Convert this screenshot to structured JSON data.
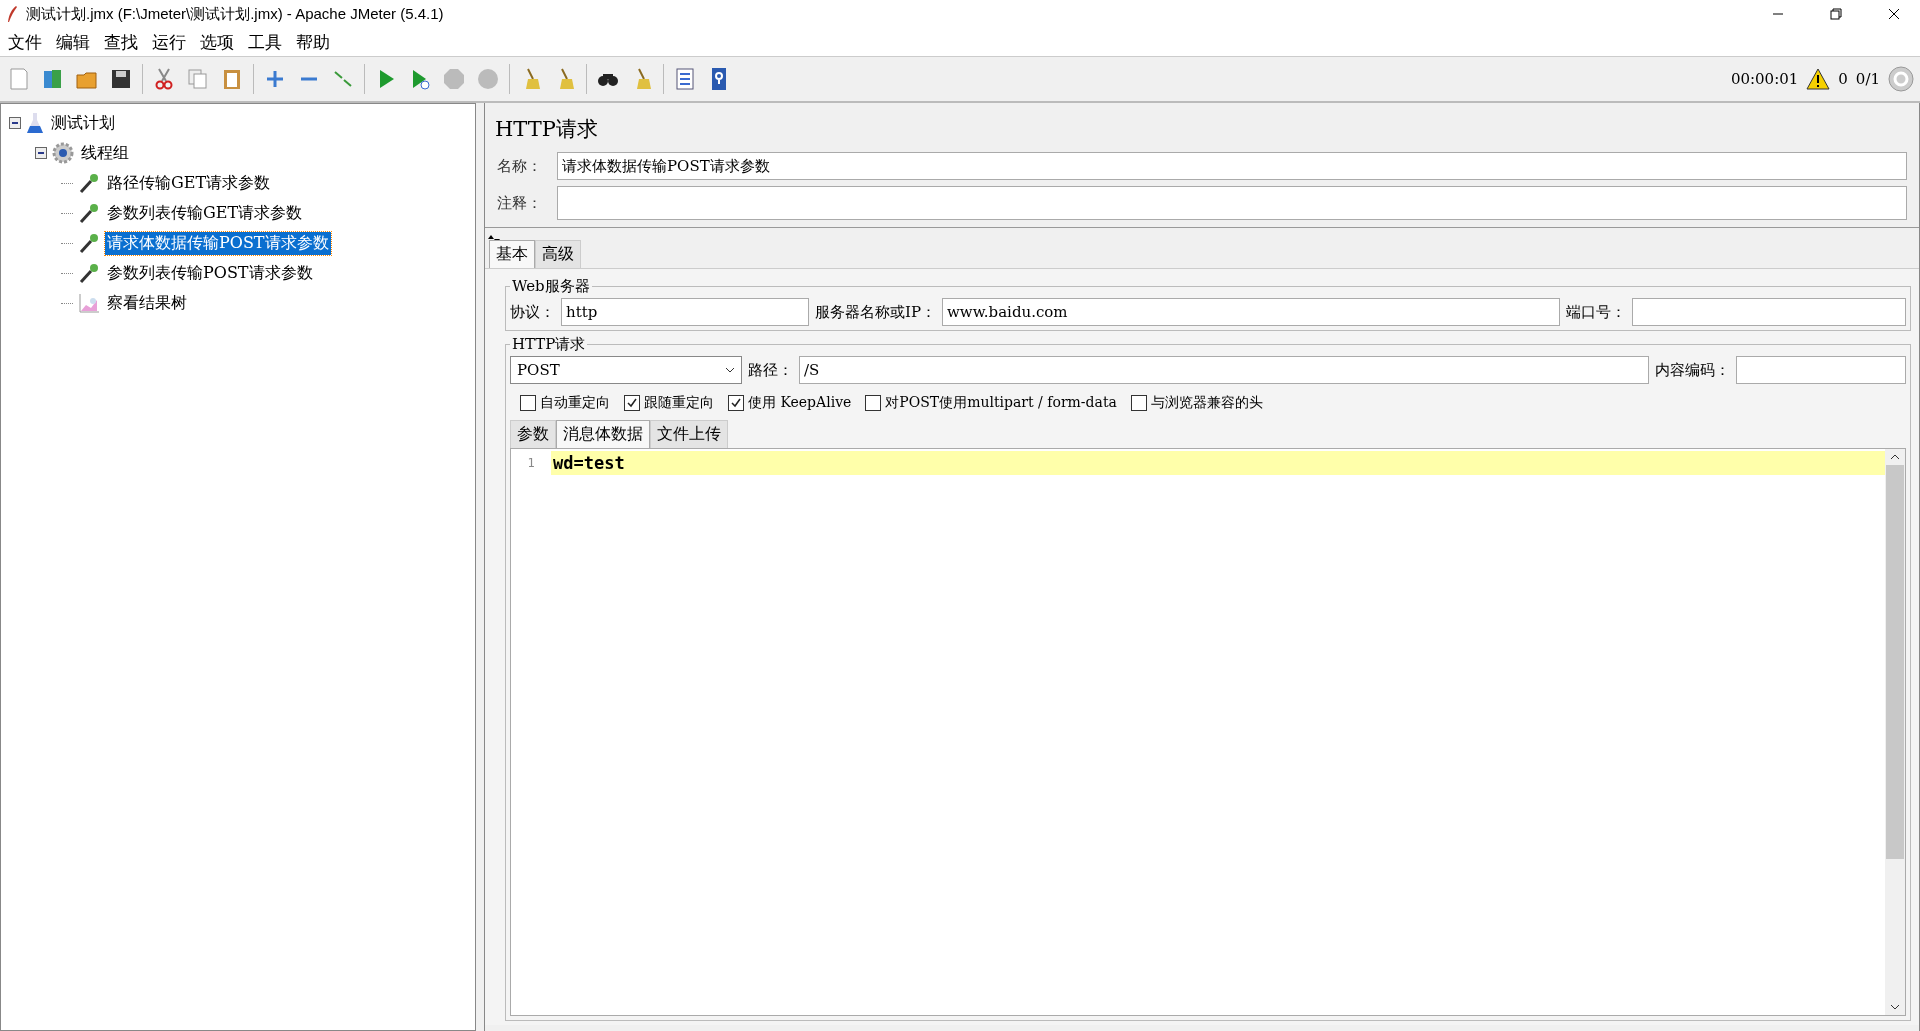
{
  "window": {
    "title": "测试计划.jmx (F:\\Jmeter\\测试计划.jmx) - Apache JMeter (5.4.1)"
  },
  "menu": [
    "文件",
    "编辑",
    "查找",
    "运行",
    "选项",
    "工具",
    "帮助"
  ],
  "toolbar": {
    "timer": "00:00:01",
    "warnings": "0",
    "threads": "0/1"
  },
  "tree": [
    {
      "label": "测试计划",
      "kind": "plan",
      "expanded": true,
      "selected": false,
      "children": [
        {
          "label": "线程组",
          "kind": "group",
          "expanded": true,
          "selected": false,
          "children": [
            {
              "label": "路径传输GET请求参数",
              "kind": "sampler",
              "selected": false
            },
            {
              "label": "参数列表传输GET请求参数",
              "kind": "sampler",
              "selected": false
            },
            {
              "label": "请求体数据传输POST请求参数",
              "kind": "sampler",
              "selected": true
            },
            {
              "label": "参数列表传输POST请求参数",
              "kind": "sampler",
              "selected": false
            },
            {
              "label": "察看结果树",
              "kind": "listener",
              "selected": false
            }
          ]
        }
      ]
    }
  ],
  "panel": {
    "title": "HTTP请求",
    "name_label": "名称：",
    "name": "请求体数据传输POST请求参数",
    "comment_label": "注释：",
    "tabs": [
      {
        "label": "基本",
        "selected": true
      },
      {
        "label": "高级",
        "selected": false
      }
    ],
    "web_server": {
      "legend": "Web服务器",
      "protocol_label": "协议：",
      "protocol": "http",
      "server_label": "服务器名称或IP：",
      "server": "www.baidu.com",
      "port_label": "端口号："
    },
    "http_request": {
      "legend": "HTTP请求",
      "method": "POST",
      "path_label": "路径：",
      "path": "/S",
      "encoding_label": "内容编码：",
      "options": [
        {
          "label": "自动重定向",
          "checked": false
        },
        {
          "label": "跟随重定向",
          "checked": true
        },
        {
          "label": "使用 KeepAlive",
          "checked": true
        },
        {
          "label": "对POST使用multipart / form-data",
          "checked": false
        },
        {
          "label": "与浏览器兼容的头",
          "checked": false
        }
      ]
    },
    "body_tabs": [
      {
        "label": "参数",
        "selected": false
      },
      {
        "label": "消息体数据",
        "selected": true
      },
      {
        "label": "文件上传",
        "selected": false
      }
    ],
    "body_lines": [
      {
        "number": "1",
        "text": "wd=test"
      }
    ]
  }
}
